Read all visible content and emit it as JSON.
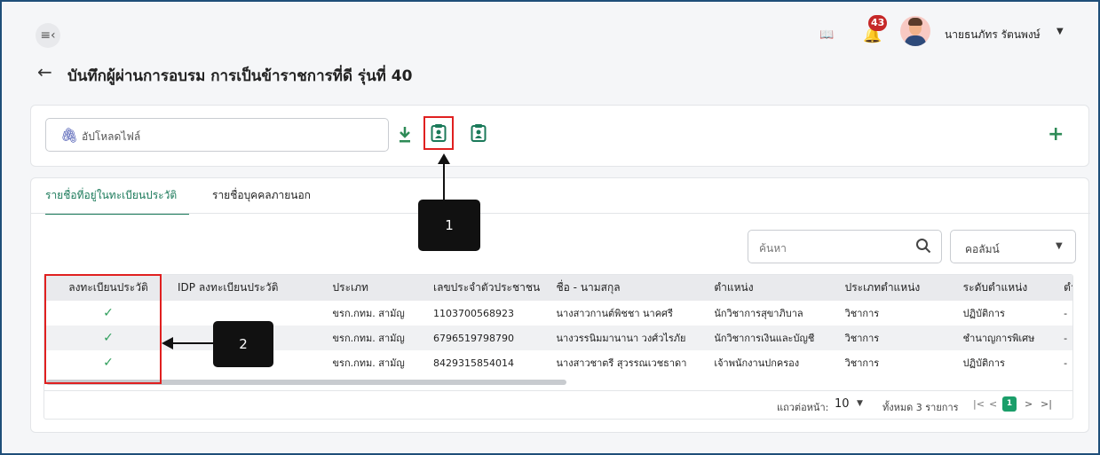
{
  "header": {
    "menu_icon": "menu-collapse-icon",
    "notifications_count": "43",
    "username": "นายธนภัทร รัตนพงษ์"
  },
  "page": {
    "title": "บันทึกผู้ผ่านการอบรม การเป็นข้าราชการที่ดี รุ่นที่ 40"
  },
  "upload": {
    "placeholder": "อัปโหลดไฟล์"
  },
  "callouts": {
    "one": "1",
    "two": "2"
  },
  "tabs": [
    {
      "label": "รายชื่อที่อยู่ในทะเบียนประวัติ",
      "active": true
    },
    {
      "label": "รายชื่อบุคคลภายนอก",
      "active": false
    }
  ],
  "search": {
    "placeholder": "ค้นหา"
  },
  "column_select": {
    "label": "คอลัมน์"
  },
  "table": {
    "headers": [
      "ลงทะเบียนประวัติ",
      "IDP ลงทะเบียนประวัติ",
      "ประเภท",
      "เลขประจำตัวประชาชน",
      "ชื่อ - นามสกุล",
      "ตำแหน่ง",
      "ประเภทตำแหน่ง",
      "ระดับตำแหน่ง",
      "ตำแหน่"
    ],
    "rows": [
      {
        "registered": "✓",
        "idp": "",
        "type": "ขรก.กทม. สามัญ",
        "citizen_id": "1103700568923",
        "name": "นางสาวกานต์พิชชา นาคศรี",
        "position": "นักวิชาการสุขาภิบาล",
        "position_type": "วิชาการ",
        "level": "ปฏิบัติการ",
        "extra": "-"
      },
      {
        "registered": "✓",
        "idp": "",
        "type": "ขรก.กทม. สามัญ",
        "citizen_id": "6796519798790",
        "name": "นางวรรนิมมานานา วงศ์วไรภัย",
        "position": "นักวิชาการเงินและบัญชี",
        "position_type": "วิชาการ",
        "level": "ชำนาญการพิเศษ",
        "extra": "-"
      },
      {
        "registered": "✓",
        "idp": "",
        "type": "ขรก.กทม. สามัญ",
        "citizen_id": "8429315854014",
        "name": "นางสาวชาตรี สุวรรณเวชธาดา",
        "position": "เจ้าพนักงานปกครอง",
        "position_type": "วิชาการ",
        "level": "ปฏิบัติการ",
        "extra": "-"
      }
    ]
  },
  "pagination": {
    "rows_per_page_label": "แถวต่อหน้า:",
    "rows_per_page": "10",
    "total_label": "ทั้งหมด 3 รายการ",
    "first": "|<",
    "prev": "<",
    "current_page": "1",
    "next": ">",
    "last": ">|"
  },
  "colors": {
    "accent": "#1b7a5a",
    "highlight": "#e02020",
    "badge": "#c62828"
  }
}
